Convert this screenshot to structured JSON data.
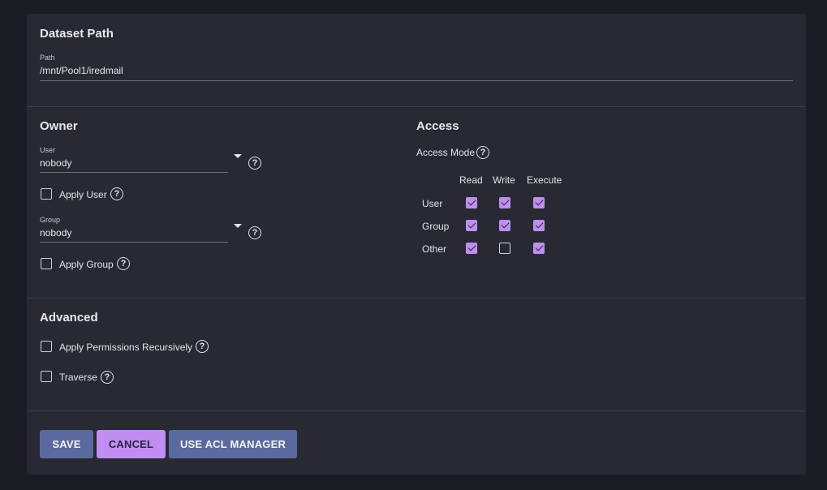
{
  "dataset": {
    "title": "Dataset Path",
    "path_label": "Path",
    "path_value": "/mnt/Pool1/iredmail"
  },
  "owner": {
    "title": "Owner",
    "user_label": "User",
    "user_value": "nobody",
    "apply_user_label": "Apply User",
    "apply_user_checked": false,
    "group_label": "Group",
    "group_value": "nobody",
    "apply_group_label": "Apply Group",
    "apply_group_checked": false
  },
  "access": {
    "title": "Access",
    "mode_label": "Access Mode",
    "columns": [
      "Read",
      "Write",
      "Execute"
    ],
    "rows": [
      {
        "label": "User",
        "values": [
          true,
          true,
          true
        ]
      },
      {
        "label": "Group",
        "values": [
          true,
          true,
          true
        ]
      },
      {
        "label": "Other",
        "values": [
          true,
          false,
          true
        ]
      }
    ]
  },
  "advanced": {
    "title": "Advanced",
    "recursive_label": "Apply Permissions Recursively",
    "recursive_checked": false,
    "traverse_label": "Traverse",
    "traverse_checked": false
  },
  "buttons": {
    "save": "SAVE",
    "cancel": "CANCEL",
    "acl": "USE ACL MANAGER"
  },
  "colors": {
    "accent": "#c08ef0",
    "primary": "#5b6a9e",
    "card": "#282932",
    "background": "#1b1c24"
  }
}
